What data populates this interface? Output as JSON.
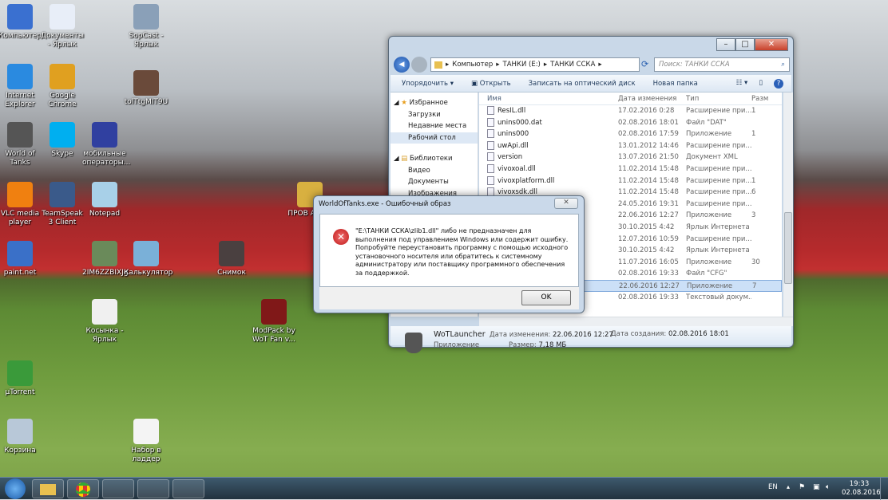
{
  "desktop": {
    "icons": [
      {
        "label": "Компьютер",
        "color": "#3a70d0"
      },
      {
        "label": "Документы - Ярлык",
        "color": "#e8eef8"
      },
      {
        "label": "SopCast - Ярлык",
        "color": "#8aa0b8"
      },
      {
        "label": "Internet Explorer",
        "color": "#2a8ae0"
      },
      {
        "label": "Google Chrome",
        "color": "#e0a020"
      },
      {
        "label": "tolTtgMIT9U",
        "color": "#6a4a3a"
      },
      {
        "label": "World of Tanks",
        "color": "#555555"
      },
      {
        "label": "Skype",
        "color": "#00aff0"
      },
      {
        "label": "мобильные операторы...",
        "color": "#3040a0"
      },
      {
        "label": "VLC media player",
        "color": "#f08010"
      },
      {
        "label": "TeamSpeak 3 Client",
        "color": "#3a5a8a"
      },
      {
        "label": "Notepad",
        "color": "#a8d0e8"
      },
      {
        "label": "ПРОВ АНТ...",
        "color": "#d8b040"
      },
      {
        "label": "paint.net",
        "color": "#3a70c8"
      },
      {
        "label": "2IM6ZZBIXJg",
        "color": "#6a8a5a"
      },
      {
        "label": "Калькулятор",
        "color": "#7ab0d8"
      },
      {
        "label": "Снимок",
        "color": "#4a4040"
      },
      {
        "label": "Косынка - Ярлык",
        "color": "#f0f0f0"
      },
      {
        "label": "ModPack by WoT Fan v...",
        "color": "#801818"
      },
      {
        "label": "µTorrent",
        "color": "#3a9a3a"
      },
      {
        "label": "Корзина",
        "color": "#b8c8d8"
      },
      {
        "label": "Набор в ладдер",
        "color": "#f4f4f4"
      }
    ]
  },
  "explorer": {
    "breadcrumb": [
      "Компьютер",
      "ТАНКИ (E:)",
      "ТАНКИ ССКА"
    ],
    "search_placeholder": "Поиск: ТАНКИ ССКА",
    "toolbar": {
      "organize": "Упорядочить",
      "open": "Открыть",
      "burn": "Записать на оптический диск",
      "new_folder": "Новая папка"
    },
    "nav": {
      "favorites": "Избранное",
      "downloads": "Загрузки",
      "recent": "Недавние места",
      "desktop": "Рабочий стол",
      "libraries": "Библиотеки",
      "video": "Видео",
      "documents": "Документы",
      "images": "Изображения"
    },
    "columns": {
      "name": "Имя",
      "date": "Дата изменения",
      "type": "Тип",
      "size": "Разм"
    },
    "rows": [
      {
        "name": "ResIL.dll",
        "date": "17.02.2016 0:28",
        "type": "Расширение при...",
        "size": "1"
      },
      {
        "name": "unins000.dat",
        "date": "02.08.2016 18:01",
        "type": "Файл \"DAT\"",
        "size": ""
      },
      {
        "name": "unins000",
        "date": "02.08.2016 17:59",
        "type": "Приложение",
        "size": "1"
      },
      {
        "name": "uwApi.dll",
        "date": "13.01.2012 14:46",
        "type": "Расширение при...",
        "size": ""
      },
      {
        "name": "version",
        "date": "13.07.2016 21:50",
        "type": "Документ XML",
        "size": ""
      },
      {
        "name": "vivoxoal.dll",
        "date": "11.02.2014 15:48",
        "type": "Расширение при...",
        "size": ""
      },
      {
        "name": "vivoxplatform.dll",
        "date": "11.02.2014 15:48",
        "type": "Расширение при...",
        "size": "1"
      },
      {
        "name": "vivoxsdk.dll",
        "date": "11.02.2014 15:48",
        "type": "Расширение при...",
        "size": "6"
      },
      {
        "name": "",
        "date": "24.05.2016 19:31",
        "type": "Расширение при...",
        "size": ""
      },
      {
        "name": "",
        "date": "22.06.2016 12:27",
        "type": "Приложение",
        "size": "3"
      },
      {
        "name": "",
        "date": "30.10.2015 4:42",
        "type": "Ярлык Интернета",
        "size": ""
      },
      {
        "name": "",
        "date": "12.07.2016 10:59",
        "type": "Расширение при...",
        "size": ""
      },
      {
        "name": "",
        "date": "30.10.2015 4:42",
        "type": "Ярлык Интернета",
        "size": ""
      },
      {
        "name": "",
        "date": "11.07.2016 16:05",
        "type": "Приложение",
        "size": "30"
      },
      {
        "name": "",
        "date": "02.08.2016 19:33",
        "type": "Файл \"CFG\"",
        "size": ""
      },
      {
        "name": "",
        "date": "22.06.2016 12:27",
        "type": "Приложение",
        "size": "7"
      },
      {
        "name": "",
        "date": "02.08.2016 19:33",
        "type": "Текстовый докум...",
        "size": ""
      }
    ],
    "details": {
      "name": "WoTLauncher",
      "kind": "Приложение",
      "modified_label": "Дата изменения:",
      "modified": "22.06.2016 12:27",
      "size_label": "Размер:",
      "size": "7,18 МБ",
      "created_label": "Дата создания:",
      "created": "02.08.2016 18:01"
    }
  },
  "dialog": {
    "title": "WorldOfTanks.exe - Ошибочный образ",
    "message": "\"E:\\ТАНКИ ССКА\\zlib1.dll\" либо не предназначен для выполнения под управлением Windows или содержит ошибку. Попробуйте переустановить программу с помощью исходного установочного носителя или обратитесь к системному администратору или поставщику программного обеспечения за поддержкой.",
    "ok": "OK",
    "close": "✕"
  },
  "taskbar": {
    "lang": "EN",
    "time": "19:33",
    "date": "02.08.2016"
  }
}
